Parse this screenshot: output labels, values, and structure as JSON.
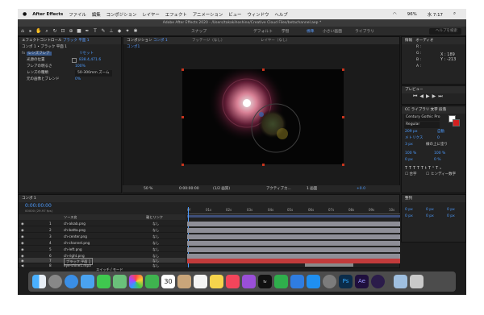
{
  "menubar": {
    "app_name": "After Effects",
    "items": [
      "ファイル",
      "編集",
      "コンポジション",
      "レイヤー",
      "エフェクト",
      "アニメーション",
      "ビュー",
      "ウィンドウ",
      "ヘルプ"
    ],
    "battery": "96%",
    "clock": "水 7:17"
  },
  "window": {
    "title": "Adobe After Effects 2020 - /Users/takakihoshino/Creative Cloud Files/betachannel.aep *"
  },
  "toolbar": {
    "snap_label": "スナップ",
    "workspaces": [
      "デフォルト",
      "学習",
      "標準",
      "小さい画面",
      "ライブラリ"
    ],
    "search_placeholder": "ヘルプを検索"
  },
  "effect_panel": {
    "tab": "エフェクトコントロール",
    "tab_target": "ブラック 平面 1",
    "breadcrumb": "コンポ 1 • ブラック 平面 1",
    "effect_name": "レンズフレア",
    "reset_label": "リセット",
    "props": [
      {
        "label": "光源の位置",
        "value": "838.4,471.6"
      },
      {
        "label": "フレアの明るさ",
        "value": "100%"
      },
      {
        "label": "レンズの種類",
        "value": "50-300mm ズーム"
      },
      {
        "label": "元の画像とブレンド",
        "value": "0%"
      }
    ]
  },
  "comp_panel": {
    "tab": "コンポジション",
    "tab_target": "コンポ 1",
    "footage_tab": "フッテージ（なし）",
    "layer_tab": "レイヤー（なし）",
    "comp_tab": "コンポ1",
    "zoom": "50 %",
    "timecode": "0:00:00:00",
    "resolution": "(1/2 画質)",
    "camera": "アクティブカ...",
    "view": "1 画面",
    "exposure": "+0.0"
  },
  "info_panel": {
    "tabs": [
      "情報",
      "オーディオ"
    ],
    "r_label": "R :",
    "g_label": "G :",
    "b_label": "B :",
    "a_label": "A :",
    "x_label": "X : 189",
    "y_label": "Y : -213"
  },
  "preview_panel": {
    "title": "プレビュー"
  },
  "character_panel": {
    "tabs": [
      "CC ライブラリ",
      "文字",
      "段落"
    ],
    "font": "Century Gothic Pro",
    "style": "Regular",
    "size": "209 px",
    "auto": "自動",
    "kerning": "メトリクス",
    "tracking": "0",
    "stroke": "3 px",
    "stroke_type": "線の上に塗り",
    "scale_v": "100 %",
    "scale_h": "100 %",
    "baseline": "0 px",
    "tsume": "0 %",
    "ligature_label": "合字",
    "hindi_label": "ヒンディー数字"
  },
  "align_panel": {
    "title": "整列",
    "rows": [
      {
        "a": "0 px",
        "b": "0 px",
        "c": "0 px"
      },
      {
        "a": "0 px",
        "b": "0 px",
        "c": "0 px"
      }
    ]
  },
  "timeline": {
    "tab": "コンポ 1",
    "timecode": "0:00:00:00",
    "fps_info": "00000 (29.97 fps)",
    "col_source": "ソース名",
    "col_parent": "親とリンク",
    "ruler": [
      "0f",
      "01s",
      "02s",
      "03s",
      "04s",
      "05s",
      "06s",
      "07s",
      "08s",
      "09s",
      "10s"
    ],
    "switch_mode": "スイッチ / モード",
    "layers": [
      {
        "num": "1",
        "name": "ch-alsab.png",
        "parent": "なし"
      },
      {
        "num": "2",
        "name": "ch-batta.png",
        "parent": "なし"
      },
      {
        "num": "3",
        "name": "ch-center.png",
        "parent": "なし"
      },
      {
        "num": "4",
        "name": "ch-channel.png",
        "parent": "なし"
      },
      {
        "num": "5",
        "name": "ch-left.png",
        "parent": "なし"
      },
      {
        "num": "6",
        "name": "ch-right.png",
        "parent": "なし"
      },
      {
        "num": "7",
        "name": "ブラック 平面 1",
        "parent": "なし"
      },
      {
        "num": "8",
        "name": "eye-shine1.mp3",
        "parent": "なし"
      }
    ]
  },
  "dock": {
    "apps": [
      "Finder",
      "Launchpad",
      "Safari",
      "Mail",
      "Messages",
      "Maps",
      "Photos",
      "FaceTime",
      "Calendar",
      "Contacts",
      "Reminders",
      "Notes",
      "Music",
      "Podcasts",
      "TV",
      "Numbers",
      "Keynote",
      "App Store",
      "System Preferences",
      "Photoshop",
      "After Effects",
      "Media Encoder",
      "Downloads",
      "Trash"
    ],
    "calendar_day": "30"
  },
  "colors": {
    "accent": "#4d9cff",
    "red_bar": "#c23b3b",
    "layer_bar": "#8e8e97"
  }
}
